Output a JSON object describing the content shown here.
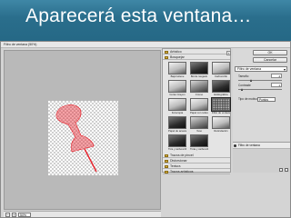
{
  "slide": {
    "title": "Aparecerá esta ventana…"
  },
  "window": {
    "title": "Filtro de ventana (50%)"
  },
  "status": {
    "zoom_value": "50%",
    "zoom_minus": "−",
    "zoom_plus": "+"
  },
  "buttons": {
    "ok": "OK",
    "cancel": "Cancelar"
  },
  "filter": {
    "selected": "Filtro de ventana"
  },
  "params": {
    "size_label": "Tamaño",
    "size_value": "4",
    "contrast_label": "Contraste",
    "contrast_value": "1",
    "size_level": 0.3,
    "contrast_level": 0.1,
    "pattern_label": "Tipo de motivo:",
    "pattern_value": "Puntos"
  },
  "gallery": {
    "section_artistic": "Artístico",
    "section_sketch": "Bosquejar",
    "thumbnails": [
      {
        "label": "Bajorrelieve",
        "style": "light"
      },
      {
        "label": "Borde rasgado",
        "style": "dark"
      },
      {
        "label": "Carboncillo",
        "style": "light"
      },
      {
        "label": "Conté Crayon",
        "style": "light"
      },
      {
        "label": "Cromo",
        "style": "mid"
      },
      {
        "label": "Estilográfica",
        "style": "dark"
      },
      {
        "label": "Fotocopia",
        "style": "light"
      },
      {
        "label": "Papel con relieve",
        "style": "light"
      },
      {
        "label": "Filtro de ventana",
        "style": "selected"
      },
      {
        "label": "Papel de acuarela",
        "style": "dark"
      },
      {
        "label": "Yeso",
        "style": "mid"
      },
      {
        "label": "Reticulación",
        "style": "light"
      },
      {
        "label": "Tiza y carboncillo",
        "style": "dark"
      },
      {
        "label": "Tinta y carboncillo",
        "style": "dark"
      }
    ],
    "section_brush": "Trazos de pincel",
    "section_distort": "Distorsionar",
    "section_texture": "Textura",
    "section_stylize": "Trazos artísticos"
  },
  "layers": {
    "active": "Filtro de ventana"
  },
  "colors": {
    "accent_red": "#e8202a",
    "slide_bg": "#1c5d79"
  }
}
